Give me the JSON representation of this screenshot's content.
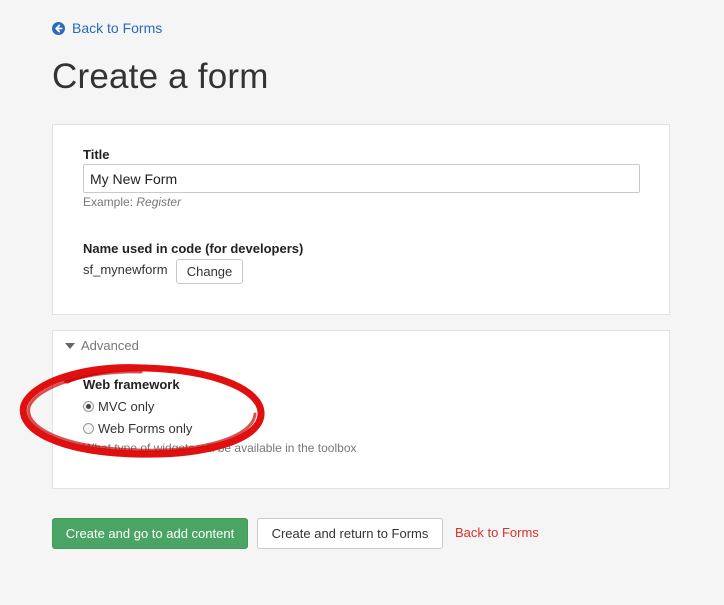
{
  "nav": {
    "back_label": "Back to Forms",
    "back_icon": "circle-arrow-left-icon"
  },
  "page": {
    "title": "Create a form"
  },
  "form": {
    "title_label": "Title",
    "title_value": "My New Form",
    "title_hint_prefix": "Example:",
    "title_hint_example": "Register",
    "code_name_label": "Name used in code (for developers)",
    "code_name_value": "sf_mynewform",
    "change_button": "Change"
  },
  "advanced": {
    "toggle_label": "Advanced",
    "framework_label": "Web framework",
    "options": [
      {
        "label": "MVC only",
        "selected": true
      },
      {
        "label": "Web Forms only",
        "selected": false
      }
    ],
    "help_text": "What type of widgets will be available in the toolbox"
  },
  "actions": {
    "create_add_content": "Create and go to add content",
    "create_return": "Create and return to Forms",
    "back_link": "Back to Forms"
  },
  "colors": {
    "link": "#2a6ab8",
    "primary_button": "#4aa463",
    "cancel_link": "#d9302c",
    "annotation": "#e01010"
  }
}
